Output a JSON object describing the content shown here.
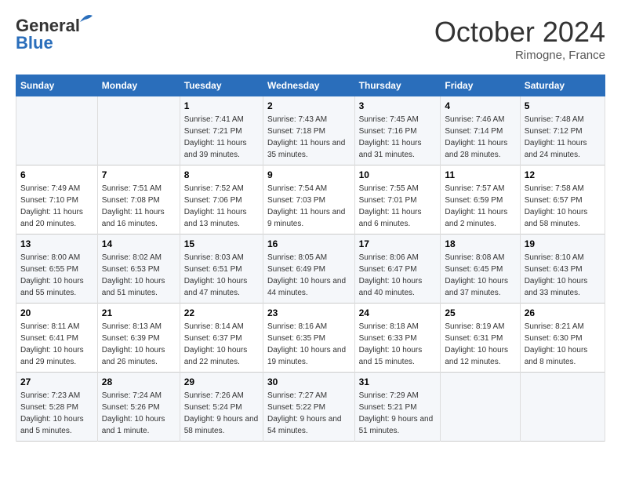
{
  "header": {
    "logo_line1": "General",
    "logo_line2": "Blue",
    "month": "October 2024",
    "location": "Rimogne, France"
  },
  "weekdays": [
    "Sunday",
    "Monday",
    "Tuesday",
    "Wednesday",
    "Thursday",
    "Friday",
    "Saturday"
  ],
  "weeks": [
    [
      {
        "day": "",
        "sunrise": "",
        "sunset": "",
        "daylight": ""
      },
      {
        "day": "",
        "sunrise": "",
        "sunset": "",
        "daylight": ""
      },
      {
        "day": "1",
        "sunrise": "Sunrise: 7:41 AM",
        "sunset": "Sunset: 7:21 PM",
        "daylight": "Daylight: 11 hours and 39 minutes."
      },
      {
        "day": "2",
        "sunrise": "Sunrise: 7:43 AM",
        "sunset": "Sunset: 7:18 PM",
        "daylight": "Daylight: 11 hours and 35 minutes."
      },
      {
        "day": "3",
        "sunrise": "Sunrise: 7:45 AM",
        "sunset": "Sunset: 7:16 PM",
        "daylight": "Daylight: 11 hours and 31 minutes."
      },
      {
        "day": "4",
        "sunrise": "Sunrise: 7:46 AM",
        "sunset": "Sunset: 7:14 PM",
        "daylight": "Daylight: 11 hours and 28 minutes."
      },
      {
        "day": "5",
        "sunrise": "Sunrise: 7:48 AM",
        "sunset": "Sunset: 7:12 PM",
        "daylight": "Daylight: 11 hours and 24 minutes."
      }
    ],
    [
      {
        "day": "6",
        "sunrise": "Sunrise: 7:49 AM",
        "sunset": "Sunset: 7:10 PM",
        "daylight": "Daylight: 11 hours and 20 minutes."
      },
      {
        "day": "7",
        "sunrise": "Sunrise: 7:51 AM",
        "sunset": "Sunset: 7:08 PM",
        "daylight": "Daylight: 11 hours and 16 minutes."
      },
      {
        "day": "8",
        "sunrise": "Sunrise: 7:52 AM",
        "sunset": "Sunset: 7:06 PM",
        "daylight": "Daylight: 11 hours and 13 minutes."
      },
      {
        "day": "9",
        "sunrise": "Sunrise: 7:54 AM",
        "sunset": "Sunset: 7:03 PM",
        "daylight": "Daylight: 11 hours and 9 minutes."
      },
      {
        "day": "10",
        "sunrise": "Sunrise: 7:55 AM",
        "sunset": "Sunset: 7:01 PM",
        "daylight": "Daylight: 11 hours and 6 minutes."
      },
      {
        "day": "11",
        "sunrise": "Sunrise: 7:57 AM",
        "sunset": "Sunset: 6:59 PM",
        "daylight": "Daylight: 11 hours and 2 minutes."
      },
      {
        "day": "12",
        "sunrise": "Sunrise: 7:58 AM",
        "sunset": "Sunset: 6:57 PM",
        "daylight": "Daylight: 10 hours and 58 minutes."
      }
    ],
    [
      {
        "day": "13",
        "sunrise": "Sunrise: 8:00 AM",
        "sunset": "Sunset: 6:55 PM",
        "daylight": "Daylight: 10 hours and 55 minutes."
      },
      {
        "day": "14",
        "sunrise": "Sunrise: 8:02 AM",
        "sunset": "Sunset: 6:53 PM",
        "daylight": "Daylight: 10 hours and 51 minutes."
      },
      {
        "day": "15",
        "sunrise": "Sunrise: 8:03 AM",
        "sunset": "Sunset: 6:51 PM",
        "daylight": "Daylight: 10 hours and 47 minutes."
      },
      {
        "day": "16",
        "sunrise": "Sunrise: 8:05 AM",
        "sunset": "Sunset: 6:49 PM",
        "daylight": "Daylight: 10 hours and 44 minutes."
      },
      {
        "day": "17",
        "sunrise": "Sunrise: 8:06 AM",
        "sunset": "Sunset: 6:47 PM",
        "daylight": "Daylight: 10 hours and 40 minutes."
      },
      {
        "day": "18",
        "sunrise": "Sunrise: 8:08 AM",
        "sunset": "Sunset: 6:45 PM",
        "daylight": "Daylight: 10 hours and 37 minutes."
      },
      {
        "day": "19",
        "sunrise": "Sunrise: 8:10 AM",
        "sunset": "Sunset: 6:43 PM",
        "daylight": "Daylight: 10 hours and 33 minutes."
      }
    ],
    [
      {
        "day": "20",
        "sunrise": "Sunrise: 8:11 AM",
        "sunset": "Sunset: 6:41 PM",
        "daylight": "Daylight: 10 hours and 29 minutes."
      },
      {
        "day": "21",
        "sunrise": "Sunrise: 8:13 AM",
        "sunset": "Sunset: 6:39 PM",
        "daylight": "Daylight: 10 hours and 26 minutes."
      },
      {
        "day": "22",
        "sunrise": "Sunrise: 8:14 AM",
        "sunset": "Sunset: 6:37 PM",
        "daylight": "Daylight: 10 hours and 22 minutes."
      },
      {
        "day": "23",
        "sunrise": "Sunrise: 8:16 AM",
        "sunset": "Sunset: 6:35 PM",
        "daylight": "Daylight: 10 hours and 19 minutes."
      },
      {
        "day": "24",
        "sunrise": "Sunrise: 8:18 AM",
        "sunset": "Sunset: 6:33 PM",
        "daylight": "Daylight: 10 hours and 15 minutes."
      },
      {
        "day": "25",
        "sunrise": "Sunrise: 8:19 AM",
        "sunset": "Sunset: 6:31 PM",
        "daylight": "Daylight: 10 hours and 12 minutes."
      },
      {
        "day": "26",
        "sunrise": "Sunrise: 8:21 AM",
        "sunset": "Sunset: 6:30 PM",
        "daylight": "Daylight: 10 hours and 8 minutes."
      }
    ],
    [
      {
        "day": "27",
        "sunrise": "Sunrise: 7:23 AM",
        "sunset": "Sunset: 5:28 PM",
        "daylight": "Daylight: 10 hours and 5 minutes."
      },
      {
        "day": "28",
        "sunrise": "Sunrise: 7:24 AM",
        "sunset": "Sunset: 5:26 PM",
        "daylight": "Daylight: 10 hours and 1 minute."
      },
      {
        "day": "29",
        "sunrise": "Sunrise: 7:26 AM",
        "sunset": "Sunset: 5:24 PM",
        "daylight": "Daylight: 9 hours and 58 minutes."
      },
      {
        "day": "30",
        "sunrise": "Sunrise: 7:27 AM",
        "sunset": "Sunset: 5:22 PM",
        "daylight": "Daylight: 9 hours and 54 minutes."
      },
      {
        "day": "31",
        "sunrise": "Sunrise: 7:29 AM",
        "sunset": "Sunset: 5:21 PM",
        "daylight": "Daylight: 9 hours and 51 minutes."
      },
      {
        "day": "",
        "sunrise": "",
        "sunset": "",
        "daylight": ""
      },
      {
        "day": "",
        "sunrise": "",
        "sunset": "",
        "daylight": ""
      }
    ]
  ]
}
